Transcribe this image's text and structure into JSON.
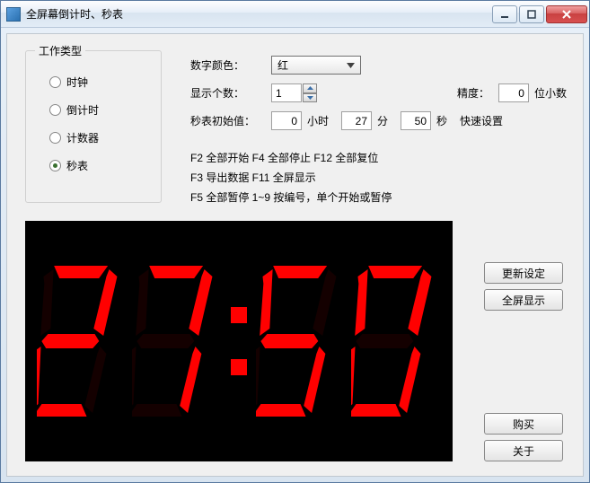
{
  "window": {
    "title": "全屏幕倒计时、秒表"
  },
  "group": {
    "title": "工作类型",
    "options": [
      {
        "label": "时钟",
        "checked": false
      },
      {
        "label": "倒计时",
        "checked": false
      },
      {
        "label": "计数器",
        "checked": false
      },
      {
        "label": "秒表",
        "checked": true
      }
    ]
  },
  "settings": {
    "color_label": "数字颜色：",
    "color_value": "红",
    "count_label": "显示个数：",
    "count_value": "1",
    "precision_label": "精度：",
    "precision_value": "0",
    "precision_unit": "位小数",
    "init_label": "秒表初始值：",
    "hour_value": "0",
    "hour_unit": "小时",
    "minute_value": "27",
    "minute_unit": "分",
    "second_value": "50",
    "second_unit": "秒",
    "quickset": "快速设置"
  },
  "help": {
    "line1": "F2 全部开始 F4 全部停止 F12 全部复位",
    "line2": "F3 导出数据 F11 全屏显示",
    "line3": "F5 全部暂停 1~9 按编号，单个开始或暂停"
  },
  "buttons": {
    "update": "更新设定",
    "fullscreen": "全屏显示",
    "buy": "购买",
    "about": "关于"
  },
  "clock": {
    "digits": "27:50",
    "color": "#ff0000"
  }
}
